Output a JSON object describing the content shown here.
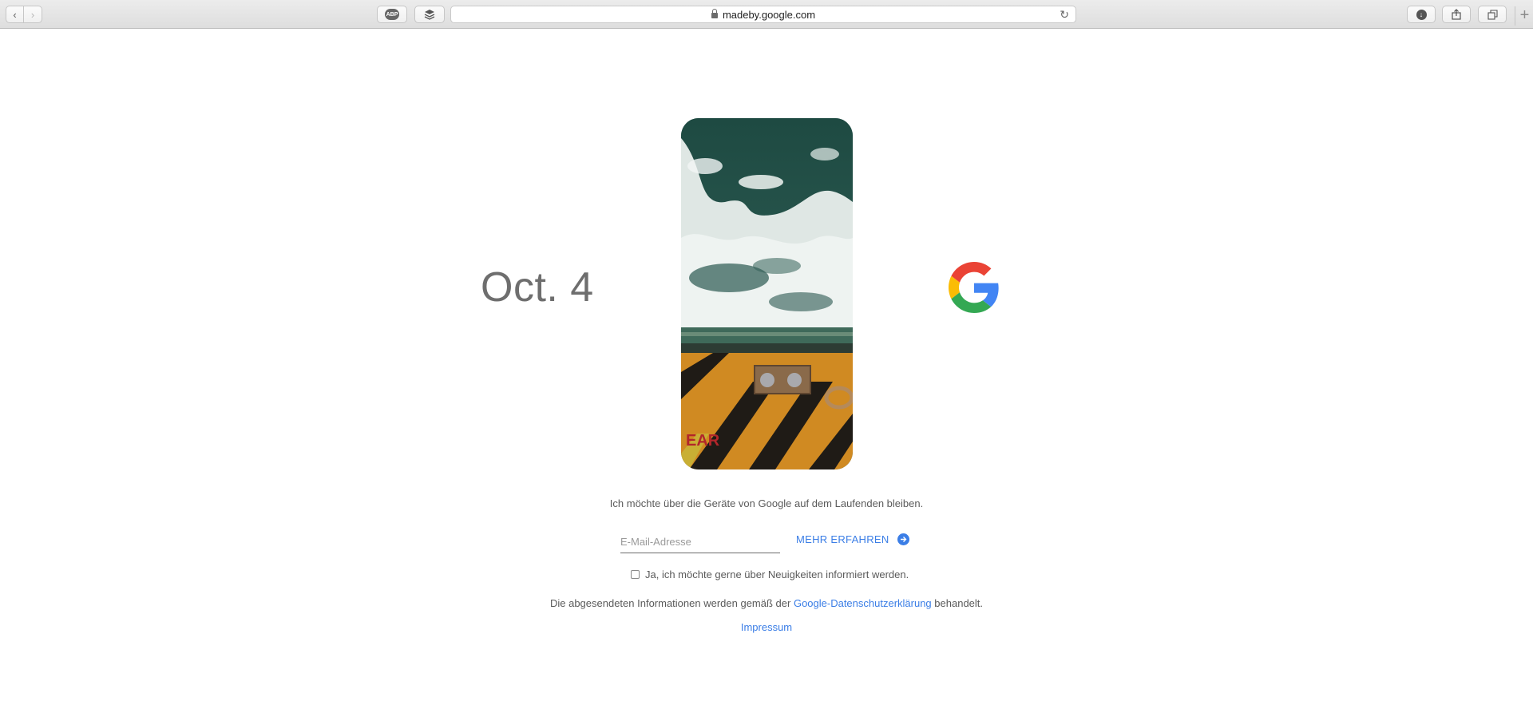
{
  "browser": {
    "url": "madeby.google.com",
    "abp_label": "ABP",
    "new_tab_symbol": "+",
    "icons": [
      "back-icon",
      "forward-icon",
      "adblock-icon",
      "layers-icon",
      "lock-icon",
      "reload-icon",
      "download-icon",
      "share-icon",
      "tabs-icon",
      "new-tab-icon"
    ]
  },
  "hero": {
    "date": "Oct. 4",
    "image_label": "EAR"
  },
  "signup": {
    "prompt": "Ich möchte über die Geräte von Google auf dem Laufenden bleiben.",
    "email_placeholder": "E-Mail-Adresse",
    "email_value": "",
    "cta_label": "MEHR ERFAHREN",
    "checkbox_label": "Ja, ich möchte gerne über Neuigkeiten informiert werden.",
    "checkbox_checked": false
  },
  "footer": {
    "privacy_prefix": "Die abgesendeten Informationen werden gemäß der",
    "privacy_link": "Google-Datenschutzerklärung",
    "privacy_suffix": "behandelt.",
    "impressum": "Impressum"
  },
  "colors": {
    "link": "#3b7ee6",
    "text": "#5a5a5a",
    "google_blue": "#4285F4",
    "google_red": "#EA4335",
    "google_yellow": "#FBBC05",
    "google_green": "#34A853"
  }
}
